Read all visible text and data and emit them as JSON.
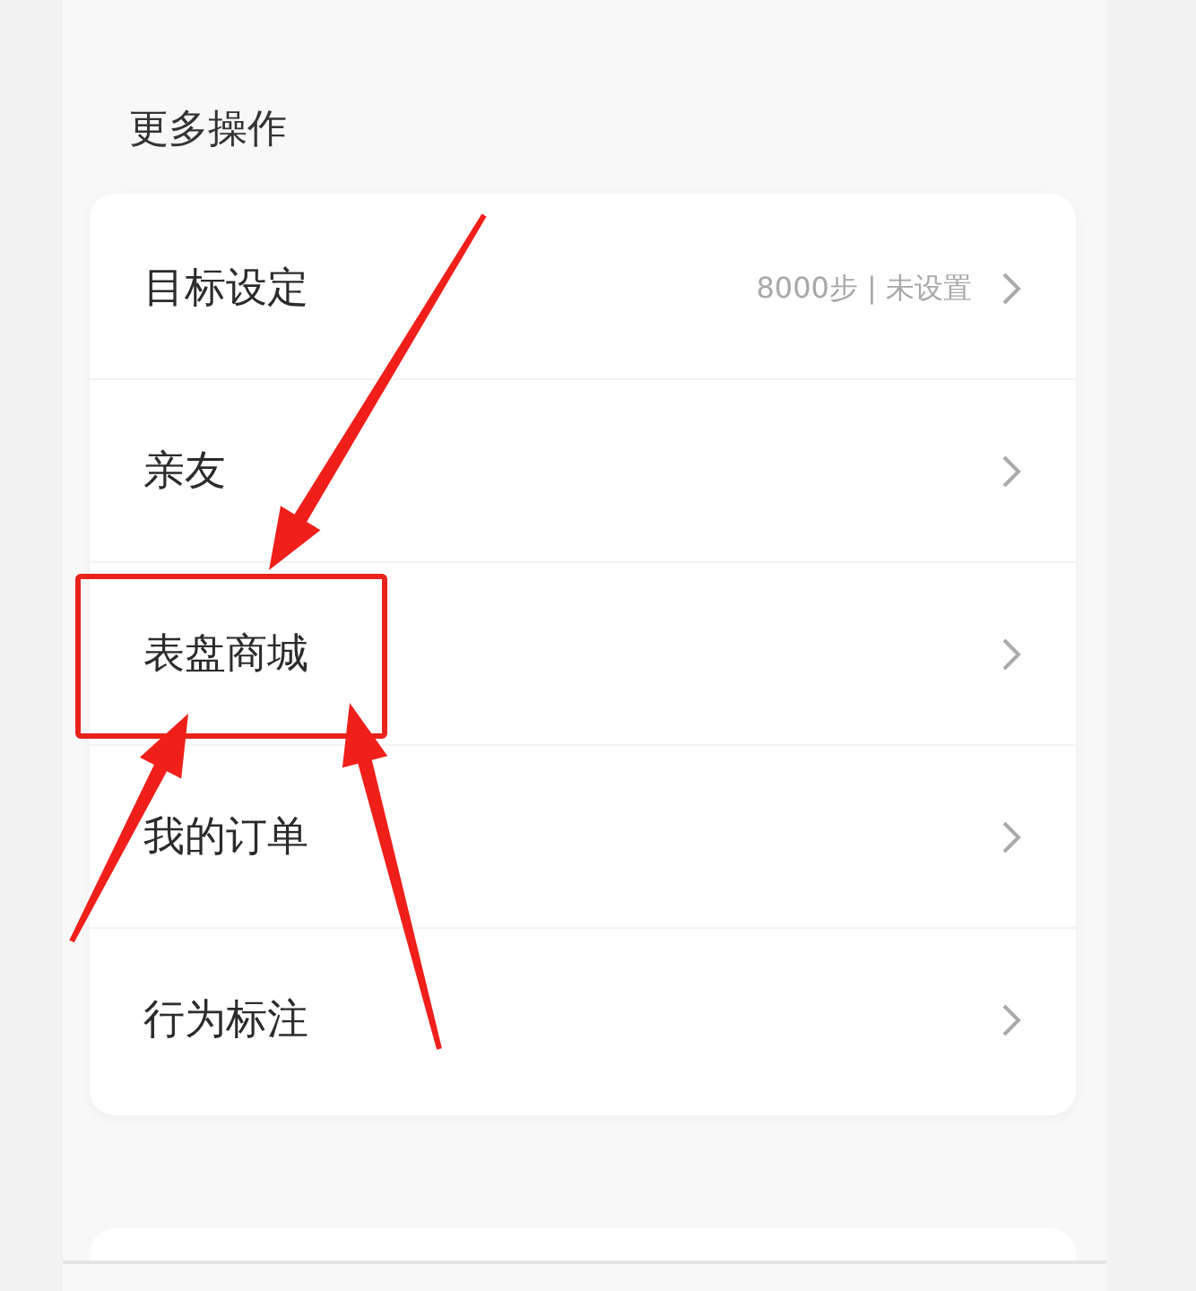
{
  "section_title": "更多操作",
  "items": [
    {
      "label": "目标设定",
      "value": "8000步 | 未设置",
      "highlighted": false
    },
    {
      "label": "亲友",
      "highlighted": false
    },
    {
      "label": "表盘商城",
      "highlighted": true
    },
    {
      "label": "我的订单",
      "highlighted": false
    },
    {
      "label": "行为标注",
      "highlighted": false
    }
  ]
}
